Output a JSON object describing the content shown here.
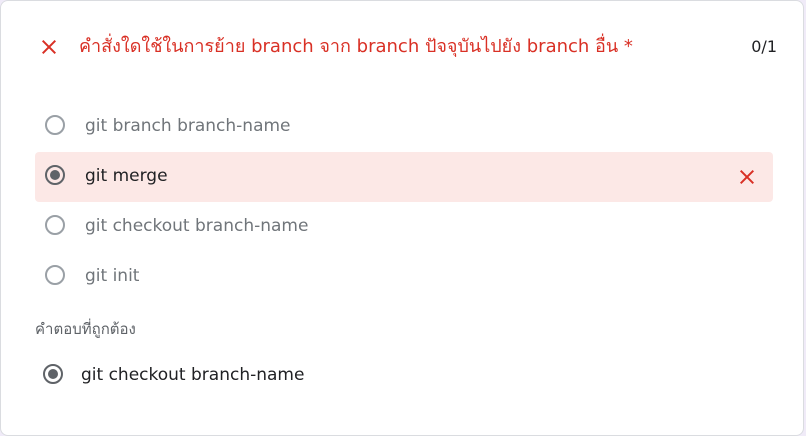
{
  "question": {
    "title": "คำสั่งใดใช้ในการย้าย branch จาก branch ปัจจุบันไปยัง branch อื่น *",
    "score": "0/1",
    "status": "incorrect",
    "status_icon": "close-icon",
    "title_color": "#d93025"
  },
  "options": [
    {
      "label": "git branch branch-name",
      "selected": false
    },
    {
      "label": "git merge",
      "selected": true,
      "marked": "wrong"
    },
    {
      "label": "git checkout branch-name",
      "selected": false
    },
    {
      "label": "git init",
      "selected": false
    }
  ],
  "correct_answer": {
    "heading": "คำตอบที่ถูกต้อง",
    "label": "git checkout branch-name"
  },
  "colors": {
    "error": "#d93025",
    "error_bg": "#fce8e6",
    "text": "#202124",
    "muted": "#70757a"
  }
}
